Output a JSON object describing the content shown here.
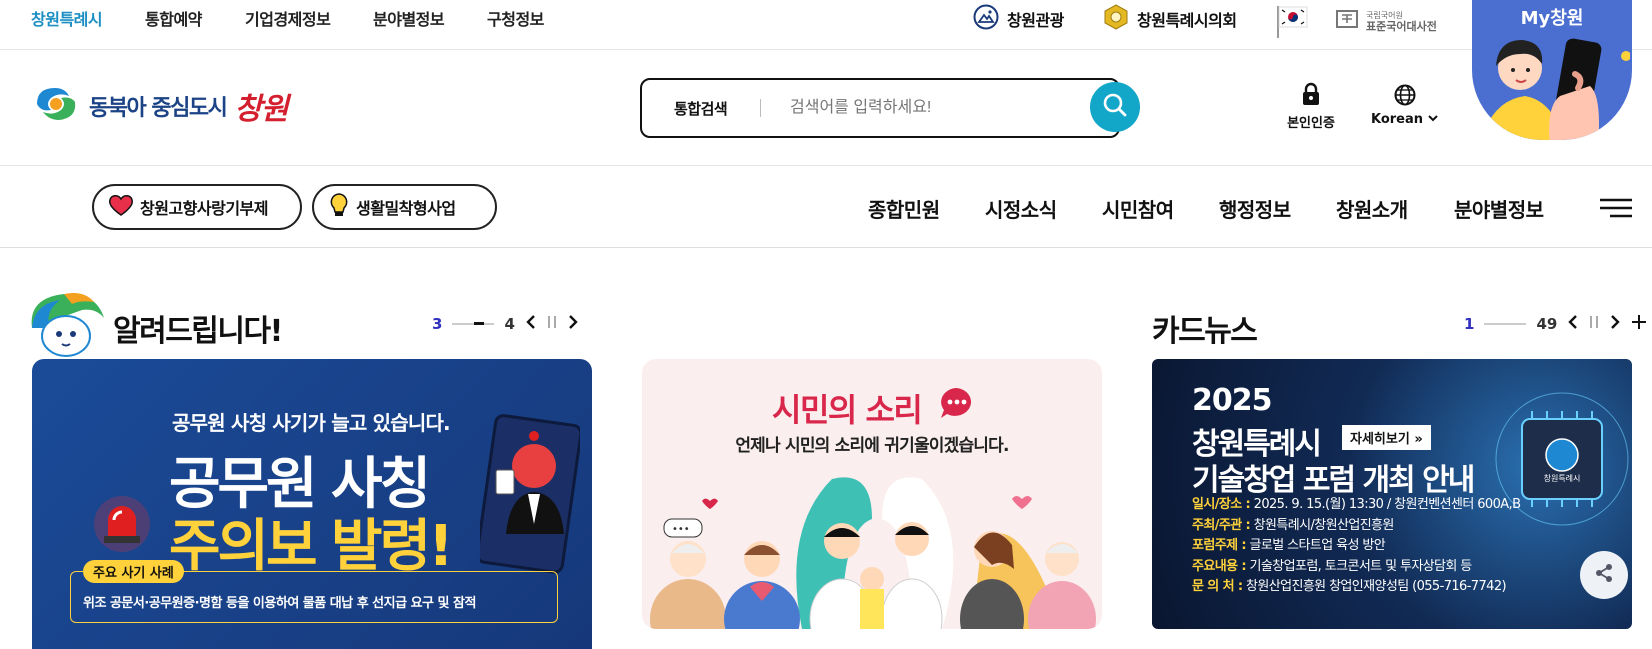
{
  "topbar": {
    "links": [
      "창원특례시",
      "통합예약",
      "기업경제정보",
      "분야별정보",
      "구청정보"
    ],
    "tourism": "창원관광",
    "council": "창원특례시의회",
    "dictionary_line1": "국립국어원",
    "dictionary_line2": "표준국어대사전"
  },
  "mychangwon": {
    "label": "My창원"
  },
  "header": {
    "logo_text": "동북아 중심도시",
    "logo_script": "창원",
    "search_label": "통합검색",
    "search_placeholder": "검색어를 입력하세요!",
    "auth_label": "본인인증",
    "lang_label": "Korean"
  },
  "gnb": {
    "pills": [
      "창원고향사랑기부제",
      "생활밀착형사업"
    ],
    "menus": [
      "종합민원",
      "시정소식",
      "시민참여",
      "행정정보",
      "창원소개",
      "분야별정보"
    ]
  },
  "notice": {
    "title": "알려드립니다!",
    "current": "3",
    "total": "4",
    "banner": {
      "line1": "공무원 사칭 사기가 늘고 있습니다.",
      "big1": "공무원 사칭",
      "big2": "주의보 발령!",
      "tag": "주요 사기 사례",
      "example": "위조 공문서·공무원증·명함 등을 이용하여 물품 대납 후 선지급 요구 및 잠적"
    }
  },
  "voice": {
    "title": "시민의 소리",
    "subtitle": "언제나 시민의 소리에 귀기울이겠습니다."
  },
  "cardnews": {
    "title": "카드뉴스",
    "current": "1",
    "total": "49",
    "year": "2025",
    "headline1": "창원특례시",
    "more": "자세히보기 »",
    "headline2": "기술창업 포럼 개최 안내",
    "chip": "창원특례시",
    "rows": [
      {
        "label": "일시/장소 :",
        "value": "2025. 9. 15.(월) 13:30 / 창원컨벤션센터 600A,B"
      },
      {
        "label": "주최/주관 :",
        "value": "창원특례시/창원산업진흥원"
      },
      {
        "label": "포럼주제 :",
        "value": "글로벌 스타트업 육성 방안"
      },
      {
        "label": "주요내용 :",
        "value": "기술창업포럼, 토크콘서트 및 투자상담회 등"
      },
      {
        "label": "문 의 처 :",
        "value": "창원산업진흥원 창업인재양성팀 (055-716-7742)"
      }
    ]
  },
  "colors": {
    "accent": "#12a6c9",
    "active": "#1d8fc3",
    "navy": "#1b4386",
    "yellow": "#ffd13a",
    "red": "#d8274a"
  }
}
